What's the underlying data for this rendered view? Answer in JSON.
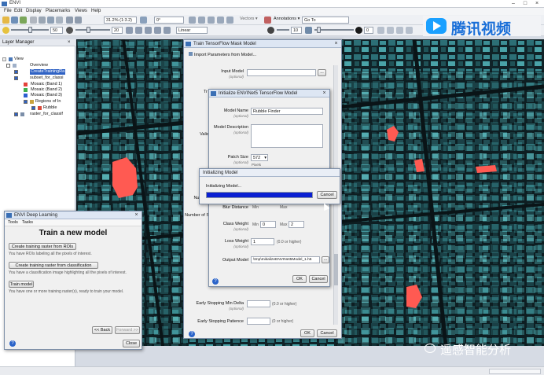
{
  "app": {
    "title": "ENVI"
  },
  "menu": [
    "File",
    "Edit",
    "Display",
    "Placemarks",
    "Views",
    "Help"
  ],
  "toolbar1": {
    "zoom_value": "31.2% (1:3.2)",
    "rotate_value": "0°",
    "vectors_label": "Vectors ▾",
    "annotations_label": "Annotations ▾",
    "goto_label": "Go To"
  },
  "toolbar2": {
    "brightness_value": "50",
    "contrast_value": "20",
    "stretch_value": "Linear",
    "sharpen_value": "10",
    "transparency_value": "0"
  },
  "watermark": {
    "top_text": "腾讯视频",
    "bottom_text": "遥感智能分析"
  },
  "layer_manager": {
    "title": "Layer Manager",
    "items": [
      {
        "label": "View",
        "checked": true
      },
      {
        "label": "Overview",
        "checked": false
      },
      {
        "label": "CreateTrainingRa",
        "checked": true,
        "selected": true
      },
      {
        "label": "subset_for_classi",
        "checked": true
      },
      {
        "label": "Mosaic (Band 1)",
        "checked": false
      },
      {
        "label": "Mosaic (Band 2)",
        "checked": false
      },
      {
        "label": "Mosaic (Band 3)",
        "checked": false
      },
      {
        "label": "Regions of In",
        "checked": true
      },
      {
        "label": "Rubble",
        "checked": true
      },
      {
        "label": "raster_for_classif",
        "checked": true
      }
    ]
  },
  "deep_learning": {
    "title": "ENVI Deep Learning",
    "menu": [
      "Tools",
      "Tasks"
    ],
    "heading": "Train a new model",
    "btn_rois": "Create training raster from ROIs",
    "desc_rois": "You have ROIs labeling all the pixels of interest.",
    "btn_class": "Create training raster from classification",
    "desc_class": "You have a classification image highlighting all the pixels of interest.",
    "btn_train": "Train model",
    "desc_train": "You have one or more training raster(s), ready to train your model.",
    "back": "<< Back",
    "forward": "Forward >>",
    "close": "Close",
    "help": "?"
  },
  "train_dialog": {
    "title": "Train TensorFlow Mask Model",
    "import": "Import Parameters from Model...",
    "input_model": "Input Model",
    "input_model_sub": "(optional)",
    "input_model_value": "",
    "tr_label": "Tr",
    "valid_label": "Valid",
    "number1_label": "Number",
    "number2_label": "Number of S",
    "esmd_label": "Early Stopping Min Delta",
    "esmd_sub": "(optional)",
    "esmd_value": "",
    "esmd_hint": "(0.0 or higher)",
    "esp_label": "Early Stopping Patience",
    "esp_value": "",
    "esp_hint": "(0 or higher)",
    "ok": "OK",
    "cancel": "Cancel",
    "help": "?"
  },
  "init_dialog": {
    "title": "Initialize ENVINet5 TensorFlow Model",
    "model_name": "Model Name",
    "model_name_sub": "(optional)",
    "model_name_value": "Rubble Finder",
    "desc": "Model Description",
    "desc_sub": "(optional)",
    "patch": "Patch Size",
    "patch_sub": "(optional)",
    "patch_value": "572",
    "patch_unit": "Pixels",
    "blur": "Blur Distance",
    "blur_min": "Min",
    "blur_max": "Max",
    "class_weight": "Class Weight",
    "class_weight_sub": "(optional)",
    "cw_min_label": "Min",
    "cw_min": "0",
    "cw_max_label": "Max",
    "cw_max": "2",
    "loss_weight": "Loss Weight",
    "loss_weight_sub": "(optional)",
    "loss_weight_value": "1",
    "loss_hint": "(0.0 or higher)",
    "output_model": "Output Model",
    "output_model_value": "\\tmp\\InitializeENVINet5Model_1.h5",
    "ok": "OK",
    "cancel": "Cancel",
    "help": "?"
  },
  "progress_dialog": {
    "title": "Initializing Model",
    "message": "Initializing Model...",
    "progress": 1.0,
    "cancel": "Cancel"
  },
  "colors": {
    "accent": "#3a6fb5",
    "progress": "#0a1fd2",
    "rubble": "#ff5a52",
    "imagery": "#2f7f86"
  }
}
